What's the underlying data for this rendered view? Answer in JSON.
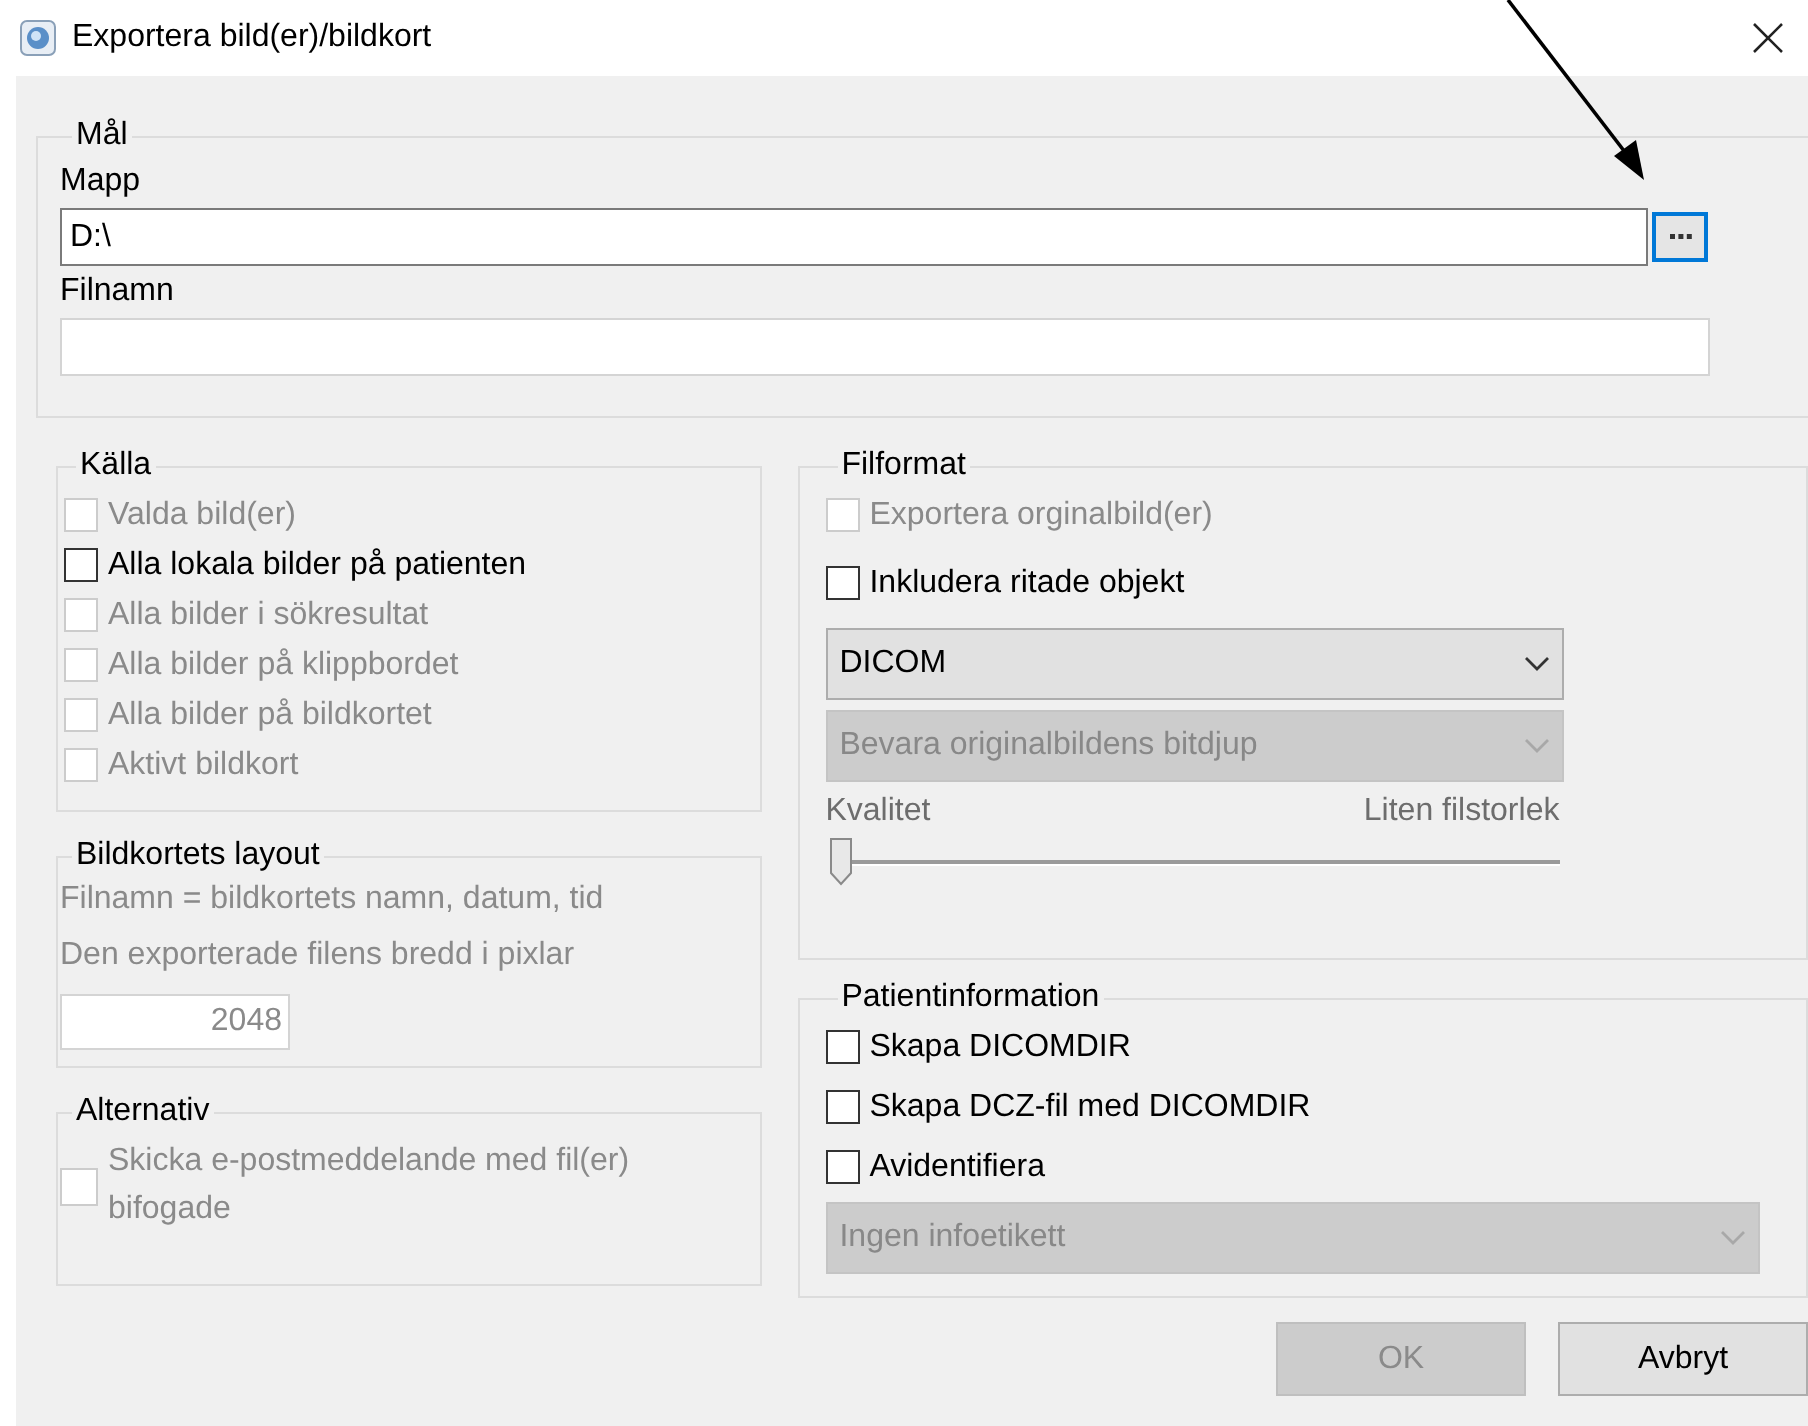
{
  "window": {
    "title": "Exportera bild(er)/bildkort"
  },
  "target": {
    "title": "Mål",
    "folder": {
      "label": "Mapp",
      "value": "D:\\"
    },
    "filename": {
      "label": "Filnamn"
    }
  },
  "source": {
    "title": "Källa",
    "options": [
      {
        "label": "Valda bild(er)",
        "checked": false,
        "disabled": true
      },
      {
        "label": "Alla lokala bilder på patienten",
        "checked": false,
        "disabled": false
      },
      {
        "label": "Alla bilder i sökresultat",
        "checked": false,
        "disabled": true
      },
      {
        "label": "Alla bilder på klippbordet",
        "checked": false,
        "disabled": true
      },
      {
        "label": "Alla bilder på bildkortet",
        "checked": false,
        "disabled": true
      },
      {
        "label": "Aktivt bildkort",
        "checked": false,
        "disabled": true
      }
    ]
  },
  "card_layout": {
    "title": "Bildkortets layout",
    "note": "Filnamn = bildkortets namn, datum, tid",
    "width_label": "Den exporterade filens bredd i pixlar",
    "width_value": "2048",
    "disabled": true
  },
  "alternatives": {
    "title": "Alternativ",
    "options": [
      {
        "label": "Skicka e-postmeddelande med fil(er) bifogade",
        "checked": false,
        "disabled": true
      }
    ]
  },
  "file_format": {
    "title": "Filformat",
    "options": [
      {
        "label": "Exportera orginalbild(er)",
        "checked": false,
        "disabled": true
      },
      {
        "label": "Inkludera ritade objekt",
        "checked": false,
        "disabled": false
      }
    ],
    "format_select": {
      "value": "DICOM",
      "disabled": false
    },
    "depth_select": {
      "value": "Bevara originalbildens bitdjup",
      "disabled": true
    },
    "quality": {
      "left_label": "Kvalitet",
      "right_label": "Liten filstorlek",
      "level": 0
    }
  },
  "patient_info": {
    "title": "Patientinformation",
    "options": [
      {
        "label": "Skapa DICOMDIR",
        "checked": false,
        "disabled": false
      },
      {
        "label": "Skapa DCZ-fil med DICOMDIR",
        "checked": false,
        "disabled": false
      },
      {
        "label": "Avidentifiera",
        "checked": false,
        "disabled": false
      }
    ],
    "label_select": {
      "value": "Ingen infoetikett",
      "disabled": true
    }
  },
  "buttons": [
    {
      "label": "OK",
      "disabled": true
    },
    {
      "label": "Avbryt",
      "disabled": false
    }
  ]
}
